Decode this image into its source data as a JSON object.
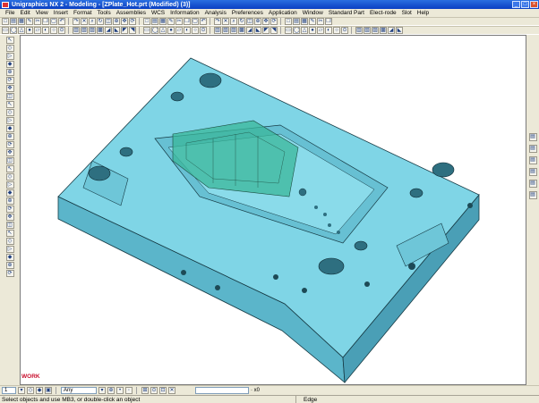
{
  "window": {
    "title": "Unigraphics NX 2 - Modeling - [ZPlate_Hot.prt (Modified)   (3)]",
    "controls": {
      "minimize": "_",
      "maximize": "□",
      "close": "×"
    }
  },
  "menubar": {
    "items": [
      "File",
      "Edit",
      "View",
      "Insert",
      "Format",
      "Tools",
      "Assemblies",
      "WCS",
      "Information",
      "Analysis",
      "Preferences",
      "Application",
      "Window",
      "Standard Part",
      "Elect-rode",
      "Slot",
      "Help"
    ]
  },
  "toolbar_row1": [
    "new",
    "open",
    "save",
    "print",
    "cut",
    "copy",
    "paste",
    "undo",
    "redo",
    "delete",
    "find",
    "refresh",
    "fit",
    "zoom",
    "pan",
    "rotate",
    "layer",
    "wcs",
    "select",
    "filter",
    "snap",
    "point",
    "line",
    "arc",
    "spline",
    "text",
    "dims",
    "shade",
    "wire",
    "hidden",
    "view",
    "orient",
    "front",
    "top",
    "right",
    "iso",
    "help",
    "about"
  ],
  "toolbar_row2": [
    "block",
    "cyl",
    "cone",
    "sphere",
    "extrude",
    "revolve",
    "hole",
    "boss",
    "pocket",
    "pad",
    "slot",
    "groove",
    "blend",
    "chamfer",
    "shell",
    "draft",
    "trim",
    "split",
    "pattern",
    "mirror",
    "unite",
    "subtract",
    "intersect",
    "sew",
    "offset",
    "scale",
    "sketch",
    "datum",
    "plane",
    "axis",
    "csys",
    "point",
    "curve",
    "surf",
    "mesh",
    "color",
    "render",
    "layer",
    "edit",
    "info",
    "measure",
    "section",
    "explode",
    "mold",
    "ejector",
    "slide"
  ],
  "left_toolbar": [
    "select",
    "pick",
    "orient",
    "snap",
    "zoom",
    "rotate",
    "pan",
    "fit",
    "view",
    "shade",
    "edge",
    "face",
    "body",
    "solid",
    "sheet",
    "curve",
    "point",
    "datum",
    "sketch",
    "feat",
    "expr",
    "part",
    "assy",
    "info",
    "layer",
    "color",
    "del",
    "undo",
    "redo",
    "help"
  ],
  "right_toolbar": [
    "roles",
    "history",
    "palette",
    "web",
    "info",
    "help"
  ],
  "viewport": {
    "work_label": "WORK",
    "model_colors": {
      "top": "#7fd6e6",
      "front": "#5eb8cc",
      "side": "#4aa2b8",
      "edge": "#1a3a44",
      "insert": "#2fb59a"
    }
  },
  "selection_bar": {
    "layer_value": "1",
    "filter_value": "Any",
    "zoom_text": "· x0"
  },
  "status": {
    "message": "Select objects and use MB3, or double-click an object",
    "selection_type": "Edge"
  }
}
